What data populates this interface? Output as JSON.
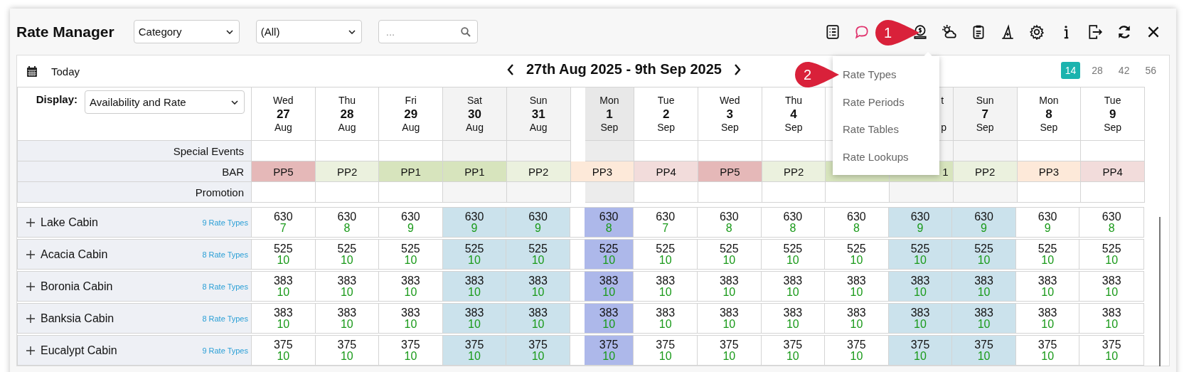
{
  "title": "Rate Manager",
  "filters": [
    {
      "kind": "select",
      "value": "Category"
    },
    {
      "kind": "select",
      "value": "(All)"
    },
    {
      "kind": "search",
      "placeholder": "..."
    }
  ],
  "callouts": [
    {
      "label": "1"
    },
    {
      "label": "2"
    }
  ],
  "menu": {
    "items": [
      {
        "label": "Rate Types"
      },
      {
        "label": "Rate Periods"
      },
      {
        "label": "Rate Tables"
      },
      {
        "label": "Rate Lookups"
      }
    ]
  },
  "nav": {
    "today": "Today",
    "range": "27th Aug 2025 - 9th Sep 2025",
    "page_sizes": [
      {
        "label": "14",
        "selected": true
      },
      {
        "label": "28",
        "selected": false
      },
      {
        "label": "42",
        "selected": false
      },
      {
        "label": "56",
        "selected": false
      }
    ]
  },
  "display": {
    "label": "Display:",
    "value": "Availability and Rate"
  },
  "days": [
    {
      "day": "Wed",
      "date": "27",
      "month": "Aug",
      "kind": "weekday"
    },
    {
      "day": "Thu",
      "date": "28",
      "month": "Aug",
      "kind": "weekday"
    },
    {
      "day": "Fri",
      "date": "29",
      "month": "Aug",
      "kind": "weekday"
    },
    {
      "day": "Sat",
      "date": "30",
      "month": "Aug",
      "kind": "weekend"
    },
    {
      "day": "Sun",
      "date": "31",
      "month": "Aug",
      "kind": "weekend"
    },
    {
      "day": "Mon",
      "date": "1",
      "month": "Sep",
      "kind": "today"
    },
    {
      "day": "Tue",
      "date": "2",
      "month": "Sep",
      "kind": "weekday"
    },
    {
      "day": "Wed",
      "date": "3",
      "month": "Sep",
      "kind": "weekday"
    },
    {
      "day": "Thu",
      "date": "4",
      "month": "Sep",
      "kind": "weekday"
    },
    {
      "kind": "weekday"
    },
    {
      "day": "t",
      "month": "p",
      "kind": "weekend",
      "partial": true
    },
    {
      "day": "Sun",
      "date": "7",
      "month": "Sep",
      "kind": "weekend"
    },
    {
      "day": "Mon",
      "date": "8",
      "month": "Sep",
      "kind": "weekday"
    },
    {
      "day": "Tue",
      "date": "9",
      "month": "Sep",
      "kind": "weekday"
    }
  ],
  "special_events": {
    "label": "Special Events"
  },
  "bar": {
    "label": "BAR",
    "cells": [
      {
        "label": "PP5",
        "color": "#e5b8b8"
      },
      {
        "label": "PP2",
        "color": "#ebf1de"
      },
      {
        "label": "PP1",
        "color": "#d7e4bd"
      },
      {
        "label": "PP1",
        "color": "#d7e4bd"
      },
      {
        "label": "PP2",
        "color": "#ebf1de"
      },
      {
        "label": "PP3",
        "color": "#fde9d9"
      },
      {
        "label": "PP4",
        "color": "#f2dcdb"
      },
      {
        "label": "PP5",
        "color": "#e5b8b8"
      },
      {
        "label": "PP2",
        "color": "#ebf1de"
      },
      {
        "color": "#d7e4bd"
      },
      {
        "label": "1",
        "color": "#d7e4bd",
        "partial": true
      },
      {
        "label": "PP2",
        "color": "#ebf1de"
      },
      {
        "label": "PP3",
        "color": "#fde9d9"
      },
      {
        "label": "PP4",
        "color": "#f2dcdb"
      }
    ]
  },
  "promotion": {
    "label": "Promotion"
  },
  "cabins": [
    {
      "name": "Lake Cabin",
      "rate_types": "9 Rate Types",
      "cells": [
        {
          "rate": "630",
          "avail": "7"
        },
        {
          "rate": "630",
          "avail": "8"
        },
        {
          "rate": "630",
          "avail": "9"
        },
        {
          "rate": "630",
          "avail": "9"
        },
        {
          "rate": "630",
          "avail": "9"
        },
        {
          "rate": "630",
          "avail": "8"
        },
        {
          "rate": "630",
          "avail": "7"
        },
        {
          "rate": "630",
          "avail": "8"
        },
        {
          "rate": "630",
          "avail": "8"
        },
        {
          "rate": "630",
          "avail": "8"
        },
        {
          "rate": "630",
          "avail": "9"
        },
        {
          "rate": "630",
          "avail": "9"
        },
        {
          "rate": "630",
          "avail": "9"
        },
        {
          "rate": "630",
          "avail": "8"
        }
      ]
    },
    {
      "name": "Acacia Cabin",
      "rate_types": "8 Rate Types",
      "cells": [
        {
          "rate": "525",
          "avail": "10"
        },
        {
          "rate": "525",
          "avail": "10"
        },
        {
          "rate": "525",
          "avail": "10"
        },
        {
          "rate": "525",
          "avail": "10"
        },
        {
          "rate": "525",
          "avail": "10"
        },
        {
          "rate": "525",
          "avail": "10"
        },
        {
          "rate": "525",
          "avail": "10"
        },
        {
          "rate": "525",
          "avail": "10"
        },
        {
          "rate": "525",
          "avail": "10"
        },
        {
          "rate": "525",
          "avail": "10"
        },
        {
          "rate": "525",
          "avail": "10"
        },
        {
          "rate": "525",
          "avail": "10"
        },
        {
          "rate": "525",
          "avail": "10"
        },
        {
          "rate": "525",
          "avail": "10"
        }
      ]
    },
    {
      "name": "Boronia Cabin",
      "rate_types": "8 Rate Types",
      "cells": [
        {
          "rate": "383",
          "avail": "10"
        },
        {
          "rate": "383",
          "avail": "10"
        },
        {
          "rate": "383",
          "avail": "10"
        },
        {
          "rate": "383",
          "avail": "10"
        },
        {
          "rate": "383",
          "avail": "10"
        },
        {
          "rate": "383",
          "avail": "10"
        },
        {
          "rate": "383",
          "avail": "10"
        },
        {
          "rate": "383",
          "avail": "10"
        },
        {
          "rate": "383",
          "avail": "10"
        },
        {
          "rate": "383",
          "avail": "10"
        },
        {
          "rate": "383",
          "avail": "10"
        },
        {
          "rate": "383",
          "avail": "10"
        },
        {
          "rate": "383",
          "avail": "10"
        },
        {
          "rate": "383",
          "avail": "10"
        }
      ]
    },
    {
      "name": "Banksia Cabin",
      "rate_types": "8 Rate Types",
      "cells": [
        {
          "rate": "383",
          "avail": "10"
        },
        {
          "rate": "383",
          "avail": "10"
        },
        {
          "rate": "383",
          "avail": "10"
        },
        {
          "rate": "383",
          "avail": "10"
        },
        {
          "rate": "383",
          "avail": "10"
        },
        {
          "rate": "383",
          "avail": "10"
        },
        {
          "rate": "383",
          "avail": "10"
        },
        {
          "rate": "383",
          "avail": "10"
        },
        {
          "rate": "383",
          "avail": "10"
        },
        {
          "rate": "383",
          "avail": "10"
        },
        {
          "rate": "383",
          "avail": "10"
        },
        {
          "rate": "383",
          "avail": "10"
        },
        {
          "rate": "383",
          "avail": "10"
        },
        {
          "rate": "383",
          "avail": "10"
        }
      ]
    },
    {
      "name": "Eucalypt Cabin",
      "rate_types": "9 Rate Types",
      "cells": [
        {
          "rate": "375",
          "avail": "10"
        },
        {
          "rate": "375",
          "avail": "10"
        },
        {
          "rate": "375",
          "avail": "10"
        },
        {
          "rate": "375",
          "avail": "10"
        },
        {
          "rate": "375",
          "avail": "10"
        },
        {
          "rate": "375",
          "avail": "10"
        },
        {
          "rate": "375",
          "avail": "10"
        },
        {
          "rate": "375",
          "avail": "10"
        },
        {
          "rate": "375",
          "avail": "10"
        },
        {
          "rate": "375",
          "avail": "10"
        },
        {
          "rate": "375",
          "avail": "10"
        },
        {
          "rate": "375",
          "avail": "10"
        },
        {
          "rate": "375",
          "avail": "10"
        },
        {
          "rate": "375",
          "avail": "10"
        }
      ]
    }
  ]
}
